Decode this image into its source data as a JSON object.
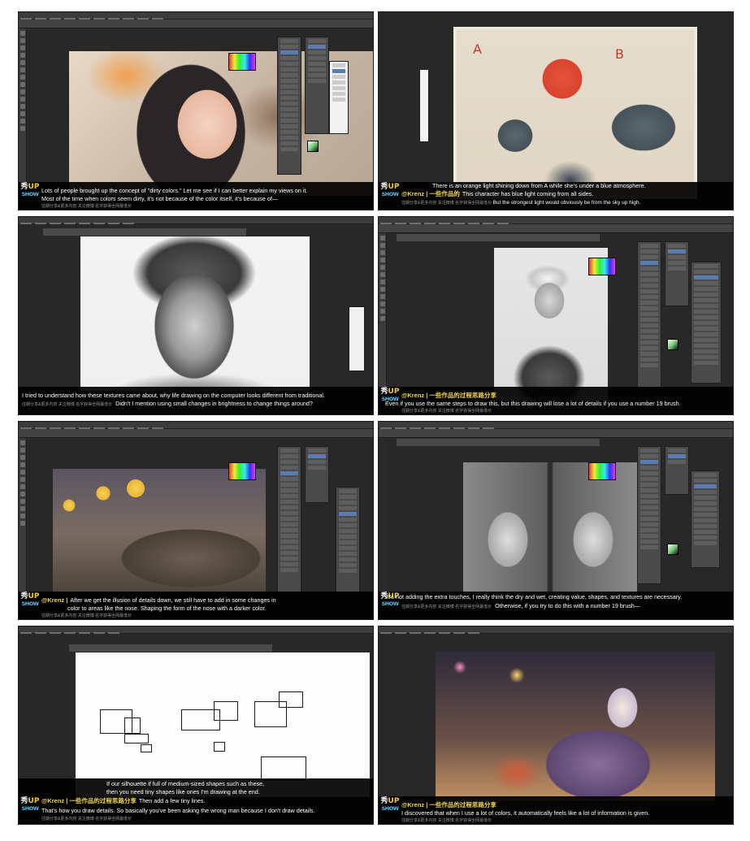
{
  "panels": [
    {
      "subtitle_top": "Lots of people brought up the concept of \"dirty colors.\" Let me see if I can better explain my views on it.",
      "subtitle_bottom": "Most of the time when colors seem dirty, it's not because of the color itself, it's because of—",
      "credit": "往期分享&更多内容 关注微博 名字获得全网最低价"
    },
    {
      "krenz_tag": "@Krenz | 一些作品的",
      "subtitle_top": "There is an orange light shining down from A while she's under a blue atmosphere.",
      "subtitle_bottom": "This character has blue light coming from all sides.",
      "subtitle_extra": "But the strongest light would obviously be from the sky up high.",
      "credit": "往期分享&更多内容 关注微博 名字获得全网最低价"
    },
    {
      "subtitle_top": "I tried to understand how these textures came about, why life drawing on the computer looks different from traditional.",
      "subtitle_bottom": "Didn't I mention using small changes in brightness to change things around?",
      "credit": "往期分享&更多内容 关注微博 名字获得全网最低价"
    },
    {
      "krenz_tag": "@Krenz | 一些作品的过程思路分享",
      "subtitle_bottom": "Even if you use the same steps to draw this, but this drawing will lose a lot of details if you use a number 19 brush.",
      "credit": "往期分享&更多内容 关注微博 名字获得全网最低价"
    },
    {
      "krenz_tag": "@Krenz |",
      "subtitle_top": "After we get the illusion of details down, we still have to add in some changes in",
      "subtitle_bottom": "color to areas like the nose.  Shaping the form of the nose with a darker color.",
      "credit": "往期分享&更多内容 关注微博 名字获得全网最低价"
    },
    {
      "subtitle_top": "It's not adding the extra touches, I really think the dry and wet, creating value, shapes, and textures are necessary.",
      "subtitle_bottom": "Otherwise, if you try to do this with a number 19 brush—",
      "credit": "往期分享&更多内容 关注微博 名字获得全网最低价"
    },
    {
      "subtitle_pre1": "If our silhouette if full of medium-sized shapes such as these,",
      "subtitle_pre2": "then you need tiny shapes like ones I'm drawing at the end.",
      "krenz_tag": "@Krenz | 一些作品的过程思路分享",
      "subtitle_top": "Then add a few tiny lines.",
      "subtitle_bottom": "That's how you draw details.  So basically you've been asking the wrong man because I don't draw details.",
      "credit": "往期分享&更多内容 关注微博 名字获得全网最低价"
    },
    {
      "krenz_tag": "@Krenz | 一些作品的过程思路分享",
      "subtitle_bottom": "I discovered that when I use a lot of colors, it automatically feels like a lot of information is given.",
      "credit": "往期分享&更多内容 关注微博 名字获得全网最低价"
    }
  ],
  "logo": {
    "line1_a": "秀",
    "line1_b": "UP",
    "line2": "SHOW"
  },
  "art_labels": {
    "a": "A",
    "b": "B"
  },
  "colors": {
    "subtitle": "#ffffff",
    "krenz": "#f2d64b",
    "ps_bg": "#2a2a2a"
  }
}
